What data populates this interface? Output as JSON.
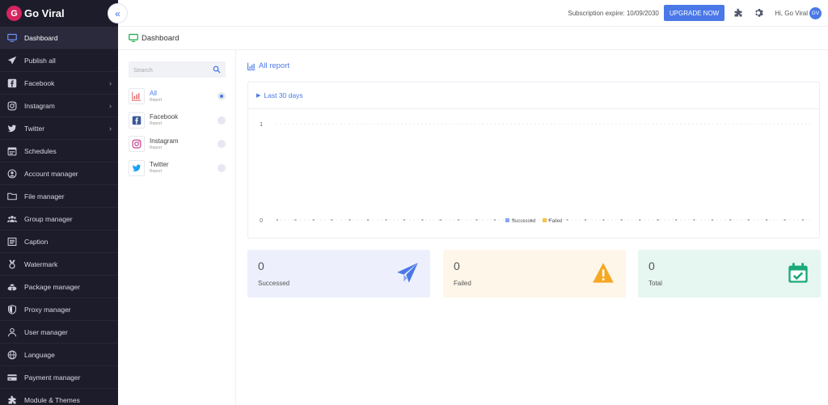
{
  "brand": {
    "name": "Go Viral",
    "logo_letter": "G"
  },
  "sidebar": {
    "items": [
      {
        "label": "Dashboard",
        "icon": "monitor-icon",
        "active": true
      },
      {
        "label": "Publish all",
        "icon": "paper-plane-icon"
      },
      {
        "label": "Facebook",
        "icon": "facebook-icon",
        "has_children": true
      },
      {
        "label": "Instagram",
        "icon": "instagram-icon",
        "has_children": true
      },
      {
        "label": "Twitter",
        "icon": "twitter-icon",
        "has_children": true
      },
      {
        "label": "Schedules",
        "icon": "calendar-icon"
      },
      {
        "label": "Account manager",
        "icon": "user-circle-icon"
      },
      {
        "label": "File manager",
        "icon": "folder-icon"
      },
      {
        "label": "Group manager",
        "icon": "users-icon"
      },
      {
        "label": "Caption",
        "icon": "caption-icon"
      },
      {
        "label": "Watermark",
        "icon": "medal-icon"
      },
      {
        "label": "Package manager",
        "icon": "package-icon"
      },
      {
        "label": "Proxy manager",
        "icon": "shield-icon"
      },
      {
        "label": "User manager",
        "icon": "user-icon"
      },
      {
        "label": "Language",
        "icon": "globe-icon"
      },
      {
        "label": "Payment manager",
        "icon": "credit-card-icon"
      },
      {
        "label": "Module & Themes",
        "icon": "puzzle-icon"
      }
    ]
  },
  "header": {
    "subscription": "Subscription expire: 10/09/2030",
    "upgrade_label": "UPGRADE NOW",
    "greeting": "Hi, Go Viral",
    "avatar_initials": "GV"
  },
  "page": {
    "title": "Dashboard"
  },
  "filter": {
    "search_placeholder": "Search",
    "items": [
      {
        "name": "All",
        "sub": "Report",
        "icon": "chart-bar-icon",
        "selected": true
      },
      {
        "name": "Facebook",
        "sub": "Report",
        "icon": "facebook-icon",
        "selected": false
      },
      {
        "name": "Instagram",
        "sub": "Report",
        "icon": "instagram-icon",
        "selected": false
      },
      {
        "name": "Twitter",
        "sub": "Report",
        "icon": "twitter-icon",
        "selected": false
      }
    ]
  },
  "report": {
    "title": "All report",
    "range_label": "Last 30 days"
  },
  "chart_data": {
    "type": "line",
    "title": "",
    "xlabel": "",
    "ylabel": "",
    "ylim": [
      0,
      1
    ],
    "yticks": [
      "0",
      "1"
    ],
    "points_count": 30,
    "series": [
      {
        "name": "Successed",
        "color": "#8aa5f2",
        "values": [
          0,
          0,
          0,
          0,
          0,
          0,
          0,
          0,
          0,
          0,
          0,
          0,
          0,
          0,
          0,
          0,
          0,
          0,
          0,
          0,
          0,
          0,
          0,
          0,
          0,
          0,
          0,
          0,
          0,
          0
        ]
      },
      {
        "name": "Failed",
        "color": "#f6c343",
        "values": [
          0,
          0,
          0,
          0,
          0,
          0,
          0,
          0,
          0,
          0,
          0,
          0,
          0,
          0,
          0,
          0,
          0,
          0,
          0,
          0,
          0,
          0,
          0,
          0,
          0,
          0,
          0,
          0,
          0,
          0
        ]
      }
    ],
    "legend": "bottom-center"
  },
  "stats": [
    {
      "value": "0",
      "label": "Successed",
      "icon": "paper-plane-icon",
      "bg": "#edf0fc",
      "color": "#4a78e8"
    },
    {
      "value": "0",
      "label": "Failed",
      "icon": "warning-icon",
      "bg": "#fef6e8",
      "color": "#f6a823"
    },
    {
      "value": "0",
      "label": "Total",
      "icon": "calendar-check-icon",
      "bg": "#e6f6f1",
      "color": "#1aaa7a"
    }
  ]
}
